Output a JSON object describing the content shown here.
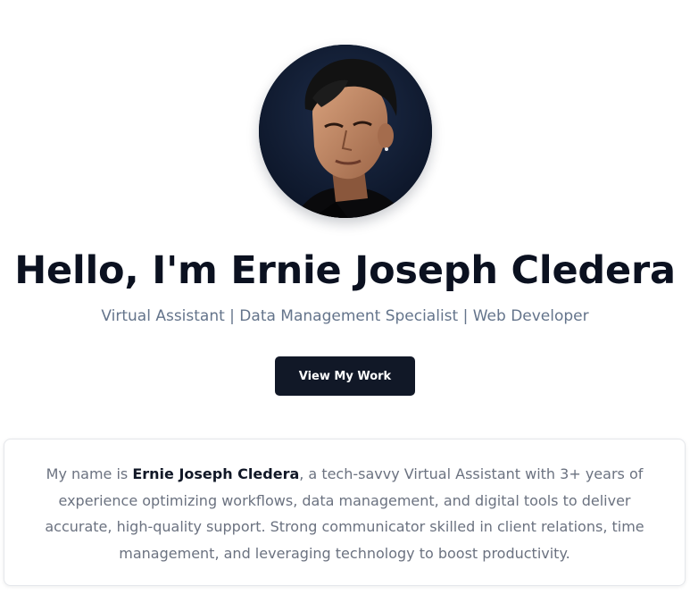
{
  "hero": {
    "avatar_alt": "Ernie Joseph Cledera profile photo",
    "title": "Hello, I'm Ernie Joseph Cledera",
    "subtitle": "Virtual Assistant | Data Management Specialist | Web Developer",
    "cta_label": "View My Work"
  },
  "about": {
    "intro": "My name is ",
    "name": "Ernie Joseph Cledera",
    "body": ", a tech-savvy Virtual Assistant with 3+ years of experience optimizing workflows, data management, and digital tools to deliver accurate, high-quality support. Strong communicator skilled in client relations, time management, and leveraging technology to boost productivity."
  },
  "colors": {
    "primary_dark": "#111827",
    "heading": "#0b1120",
    "muted_text": "#64748b",
    "avatar_bg": "#0f172a"
  }
}
